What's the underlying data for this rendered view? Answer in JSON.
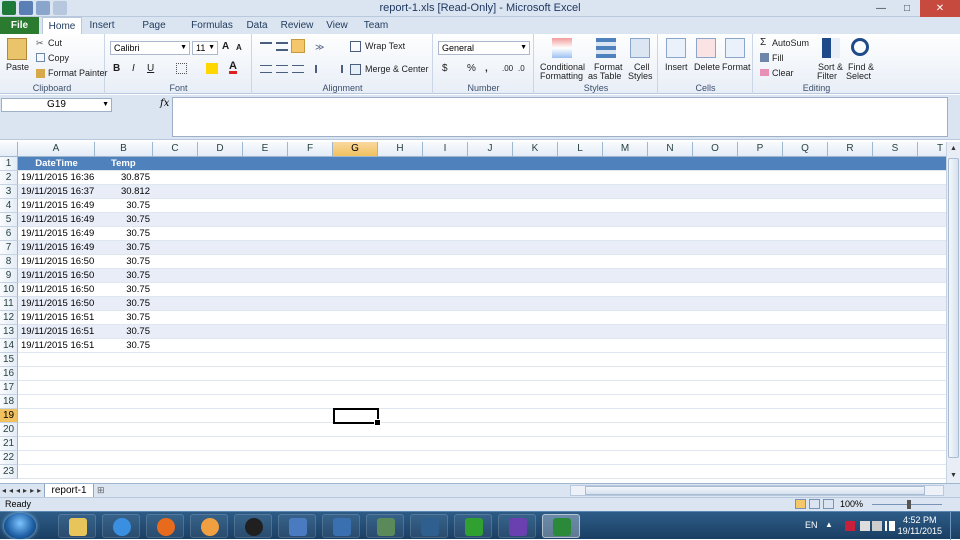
{
  "window": {
    "title": "report-1.xls  [Read-Only] - Microsoft Excel",
    "minimize": "—",
    "maximize": "□",
    "close": "✕"
  },
  "ribbon_tabs": [
    {
      "label": "File"
    },
    {
      "label": "Home"
    },
    {
      "label": "Insert"
    },
    {
      "label": "Page Layout"
    },
    {
      "label": "Formulas"
    },
    {
      "label": "Data"
    },
    {
      "label": "Review"
    },
    {
      "label": "View"
    },
    {
      "label": "Team"
    }
  ],
  "ribbon": {
    "clipboard": {
      "label": "Clipboard",
      "paste": "Paste",
      "cut": "Cut",
      "copy": "Copy",
      "format_painter": "Format Painter"
    },
    "font": {
      "label": "Font",
      "name": "Calibri",
      "size": "11",
      "bold": "B",
      "italic": "I",
      "underline": "U"
    },
    "alignment": {
      "label": "Alignment",
      "wrap_text": "Wrap Text",
      "merge_center": "Merge & Center"
    },
    "number": {
      "label": "Number",
      "format": "General",
      "currency": "$",
      "percent": "%",
      "comma": ","
    },
    "styles": {
      "label": "Styles",
      "conditional_1": "Conditional",
      "conditional_2": "Formatting",
      "format_table_1": "Format",
      "format_table_2": "as Table",
      "cell_styles_1": "Cell",
      "cell_styles_2": "Styles"
    },
    "cells": {
      "label": "Cells",
      "insert": "Insert",
      "delete": "Delete",
      "format": "Format"
    },
    "editing": {
      "label": "Editing",
      "autosum": "AutoSum",
      "fill": "Fill",
      "clear": "Clear",
      "sort_1": "Sort &",
      "sort_2": "Filter",
      "find_1": "Find &",
      "find_2": "Select"
    }
  },
  "formula_bar": {
    "name_box": "G19",
    "fx": "fx",
    "value": ""
  },
  "columns": [
    "A",
    "B",
    "C",
    "D",
    "E",
    "F",
    "G",
    "H",
    "I",
    "J",
    "K",
    "L",
    "M",
    "N",
    "O",
    "P",
    "Q",
    "R",
    "S",
    "T"
  ],
  "selected_column": "G",
  "selected_row": 19,
  "row_numbers": [
    "1",
    "2",
    "3",
    "4",
    "5",
    "6",
    "7",
    "8",
    "9",
    "10",
    "11",
    "12",
    "13",
    "14",
    "15",
    "16",
    "17",
    "18",
    "19",
    "20",
    "21",
    "22",
    "23"
  ],
  "table": {
    "headers": [
      "DateTime",
      "Temp"
    ],
    "rows": [
      [
        "19/11/2015 16:36",
        "30.875"
      ],
      [
        "19/11/2015 16:37",
        "30.812"
      ],
      [
        "19/11/2015 16:49",
        "30.75"
      ],
      [
        "19/11/2015 16:49",
        "30.75"
      ],
      [
        "19/11/2015 16:49",
        "30.75"
      ],
      [
        "19/11/2015 16:49",
        "30.75"
      ],
      [
        "19/11/2015 16:50",
        "30.75"
      ],
      [
        "19/11/2015 16:50",
        "30.75"
      ],
      [
        "19/11/2015 16:50",
        "30.75"
      ],
      [
        "19/11/2015 16:50",
        "30.75"
      ],
      [
        "19/11/2015 16:51",
        "30.75"
      ],
      [
        "19/11/2015 16:51",
        "30.75"
      ],
      [
        "19/11/2015 16:51",
        "30.75"
      ]
    ]
  },
  "sheet_tab": "report-1",
  "status": {
    "ready": "Ready",
    "zoom": "100%"
  },
  "taskbar": {
    "lang": "EN",
    "time": "4:52 PM",
    "date": "19/11/2015",
    "apps": [
      "folder-icon",
      "ie-icon",
      "firefox-icon",
      "media-player-icon",
      "app-icon",
      "network-tool-icon",
      "monitor-icon",
      "server-icon",
      "editor-icon",
      "mod-icon",
      "visual-studio-icon",
      "excel-icon"
    ]
  },
  "colors": {
    "header_blue": "#4f81bd",
    "band": "#e8edf8",
    "file_tab": "#2a7a2f"
  }
}
